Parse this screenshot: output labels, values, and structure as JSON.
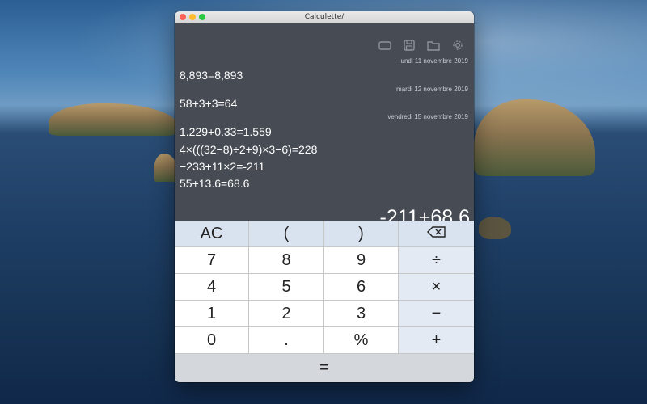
{
  "window": {
    "title": "Calculette/"
  },
  "toolbar": {
    "icons": [
      "display-icon",
      "save-icon",
      "folder-icon",
      "gear-icon"
    ]
  },
  "history": [
    {
      "date": "lundi 11 novembre 2019",
      "lines": [
        "8,893=8,893"
      ]
    },
    {
      "date": "mardi 12 novembre 2019",
      "lines": [
        "58+3+3=64"
      ]
    },
    {
      "date": "vendredi 15 novembre 2019",
      "lines": [
        "1.229+0.33=1.559",
        "4×(((32−8)÷2+9)×3−6)=228",
        "−233+11×2=-211",
        "55+13.6=68.6"
      ]
    }
  ],
  "current_expression": "-211+68.6",
  "keys": {
    "ac": "AC",
    "lparen": "(",
    "rparen": ")",
    "k7": "7",
    "k8": "8",
    "k9": "9",
    "divide": "÷",
    "k4": "4",
    "k5": "5",
    "k6": "6",
    "multiply": "×",
    "k1": "1",
    "k2": "2",
    "k3": "3",
    "minus": "−",
    "k0": "0",
    "dot": ".",
    "percent": "%",
    "plus": "+",
    "equals": "="
  }
}
